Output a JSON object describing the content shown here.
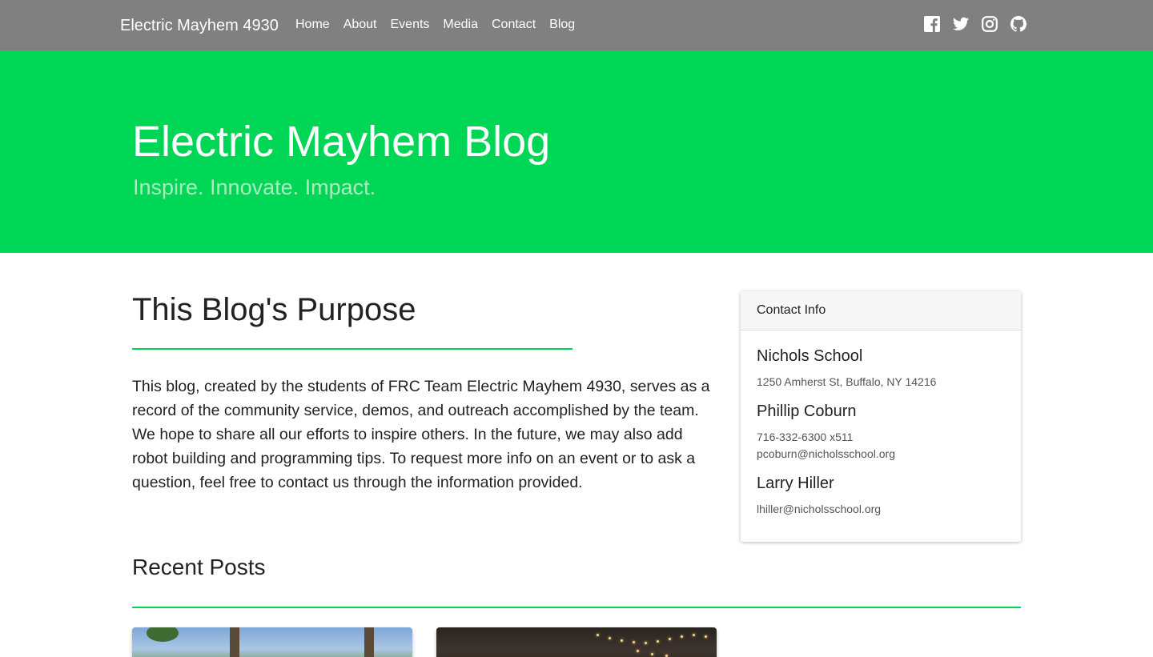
{
  "nav": {
    "brand": "Electric Mayhem 4930",
    "links": [
      "Home",
      "About",
      "Events",
      "Media",
      "Contact",
      "Blog"
    ],
    "social": [
      "facebook-icon",
      "twitter-icon",
      "instagram-icon",
      "github-icon"
    ]
  },
  "hero": {
    "title": "Electric Mayhem Blog",
    "subtitle": "Inspire. Innovate. Impact."
  },
  "purpose": {
    "title": "This Blog's Purpose",
    "body": "This blog, created by the students of FRC Team Electric Mayhem 4930, serves as a record of the community service, demos, and outreach accomplished by the team. We hope to share all our efforts to inspire others. In the future, we may also add robot building and programming tips. To request more info on an event or to ask a question, feel free to contact us through the information provided."
  },
  "recent": {
    "title": "Recent Posts"
  },
  "contact": {
    "header": "Contact Info",
    "people": [
      {
        "name": "Nichols School",
        "lines": [
          "1250 Amherst St, Buffalo, NY 14216"
        ]
      },
      {
        "name": "Phillip Coburn",
        "lines": [
          "716-332-6300 x511",
          "pcoburn@nicholsschool.org"
        ]
      },
      {
        "name": "Larry Hiller",
        "lines": [
          "lhiller@nicholsschool.org"
        ]
      }
    ]
  },
  "colors": {
    "navbar": "#808080",
    "accent": "#00d655",
    "hero_subtitle": "#a9ecc0"
  }
}
